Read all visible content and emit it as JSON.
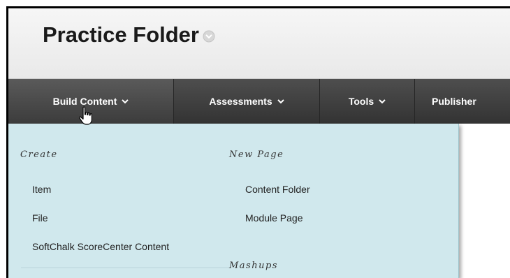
{
  "page": {
    "title": "Practice Folder"
  },
  "menu_bar": {
    "items": [
      {
        "label": "Build Content"
      },
      {
        "label": "Assessments"
      },
      {
        "label": "Tools"
      },
      {
        "label": "Publisher"
      }
    ]
  },
  "dropdown": {
    "columns": [
      {
        "heading": "Create",
        "items": [
          "Item",
          "File",
          "SoftChalk ScoreCenter Content"
        ]
      },
      {
        "heading": "New Page",
        "items": [
          "Content Folder",
          "Module Page"
        ]
      }
    ],
    "next_heading": "Mashups",
    "background": "#d0e8ed"
  },
  "colors": {
    "navbar": "#3c3c3c",
    "header": "#eeeeee",
    "accent_border": "#000000"
  },
  "icons": {
    "title_menu": "circle-chevron-down-icon",
    "nav_menu": "chevron-down-icon",
    "cursor": "hand-pointer-icon"
  }
}
